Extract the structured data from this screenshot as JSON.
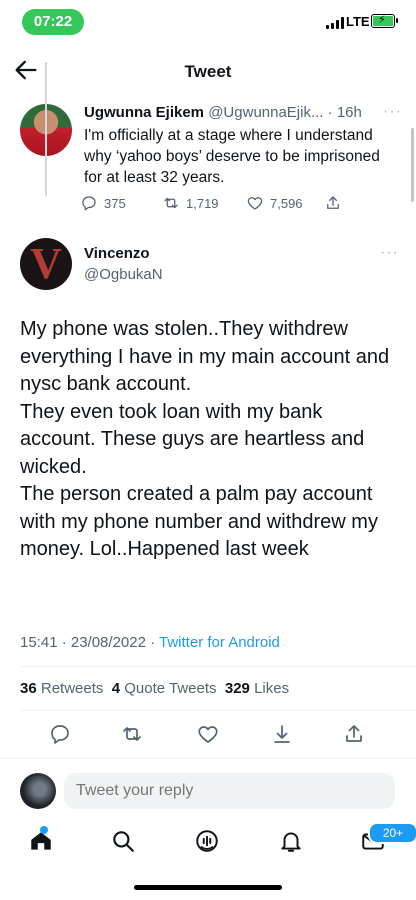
{
  "status_bar": {
    "time": "07:22",
    "network": "LTE",
    "colors": {
      "time_pill": "#34c759",
      "battery": "#34c759"
    }
  },
  "header": {
    "title": "Tweet"
  },
  "parent_tweet": {
    "name": "Ugwunna Ejikem",
    "handle": "@UgwunnaEjik...",
    "separator": "·",
    "age": "16h",
    "text": "I'm officially at a stage where I understand why ‘yahoo boys’ deserve to be imprisoned for at least 32 years.",
    "replies": "375",
    "retweets": "1,719",
    "likes": "7,596"
  },
  "main_tweet": {
    "name": "Vincenzo",
    "handle": "@OgbukaN",
    "text": "My phone was stolen..They withdrew everything I have in my main account and nysc bank account.\nThey even took loan with my bank account. These guys are heartless and wicked.\nThe person created a palm pay account with my phone number and withdrew my money. Lol..Happened last week",
    "timestamp": "15:41 · 23/08/2022",
    "meta_separator": " · ",
    "app": "Twitter for Android",
    "stats": {
      "retweets_count": "36",
      "retweets_label": "Retweets",
      "quotes_count": "4",
      "quotes_label": "Quote Tweets",
      "likes_count": "329",
      "likes_label": "Likes"
    }
  },
  "reply": {
    "placeholder": "Tweet your reply"
  },
  "nav": {
    "notifications_badge": "20+"
  },
  "accent": "#1d9bf0"
}
